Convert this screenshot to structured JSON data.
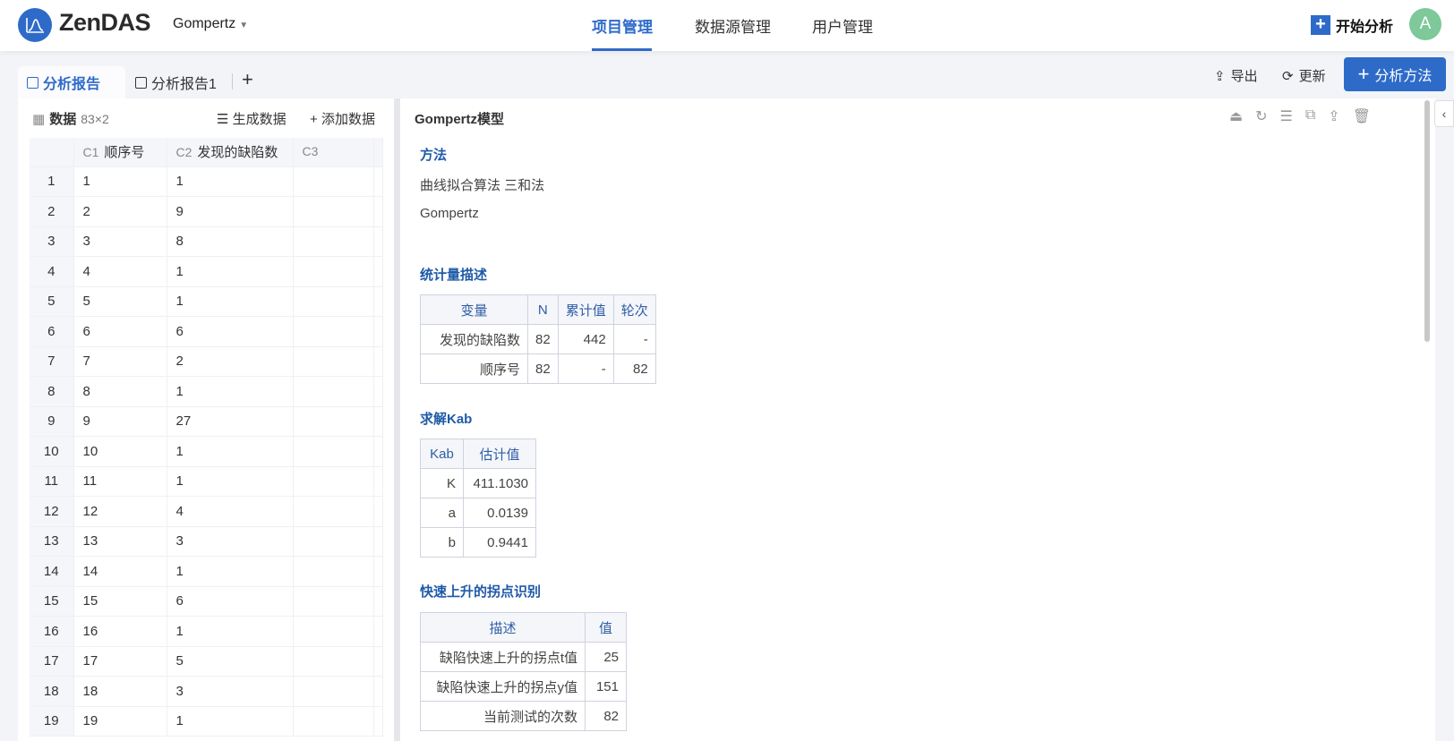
{
  "header": {
    "brand": "ZenDAS",
    "project": "Gompertz",
    "nav": [
      "项目管理",
      "数据源管理",
      "用户管理"
    ],
    "start": "开始分析",
    "avatar": "A"
  },
  "tabs": {
    "items": [
      "分析报告",
      "分析报告1"
    ],
    "add": "+"
  },
  "toolbar": {
    "export": "导出",
    "refresh": "更新",
    "add_method": "分析方法"
  },
  "data_panel": {
    "title": "数据",
    "dims": "83×2",
    "generate": "生成数据",
    "add": "添加数据",
    "columns": [
      {
        "code": "C1",
        "name": "顺序号"
      },
      {
        "code": "C2",
        "name": "发现的缺陷数"
      },
      {
        "code": "C3",
        "name": ""
      }
    ],
    "rows": [
      [
        1,
        1
      ],
      [
        2,
        9
      ],
      [
        3,
        8
      ],
      [
        4,
        1
      ],
      [
        5,
        1
      ],
      [
        6,
        6
      ],
      [
        7,
        2
      ],
      [
        8,
        1
      ],
      [
        9,
        27
      ],
      [
        10,
        1
      ],
      [
        11,
        1
      ],
      [
        12,
        4
      ],
      [
        13,
        3
      ],
      [
        14,
        1
      ],
      [
        15,
        6
      ],
      [
        16,
        1
      ],
      [
        17,
        5
      ],
      [
        18,
        3
      ],
      [
        19,
        1
      ]
    ]
  },
  "report": {
    "title": "Gompertz模型",
    "method": {
      "heading": "方法",
      "line1": "曲线拟合算法 三和法",
      "line2": "Gompertz"
    },
    "stats": {
      "heading": "统计量描述",
      "headers": [
        "变量",
        "N",
        "累计值",
        "轮次"
      ],
      "rows": [
        [
          "发现的缺陷数",
          "82",
          "442",
          "-"
        ],
        [
          "顺序号",
          "82",
          "-",
          "82"
        ]
      ]
    },
    "kab": {
      "heading": "求解Kab",
      "headers": [
        "Kab",
        "估计值"
      ],
      "rows": [
        [
          "K",
          "411.1030"
        ],
        [
          "a",
          "0.0139"
        ],
        [
          "b",
          "0.9441"
        ]
      ]
    },
    "inflection": {
      "heading": "快速上升的拐点识别",
      "headers": [
        "描述",
        "值"
      ],
      "rows": [
        [
          "缺陷快速上升的拐点t值",
          "25"
        ],
        [
          "缺陷快速上升的拐点y值",
          "151"
        ],
        [
          "当前测试的次数",
          "82"
        ]
      ]
    }
  },
  "colors": {
    "accent": "#2e6bc9",
    "avatar": "#7ec89a"
  }
}
